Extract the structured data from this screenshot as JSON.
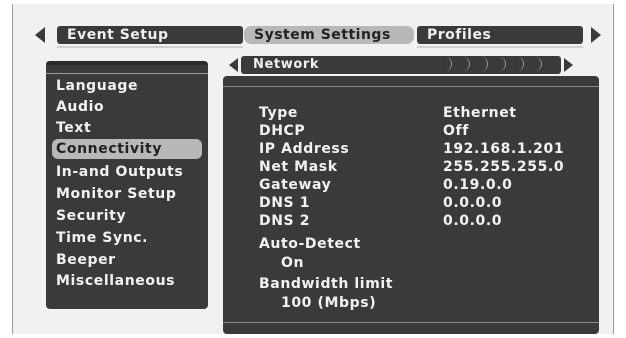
{
  "top_tabs": [
    {
      "label": "Event Setup",
      "selected": false
    },
    {
      "label": "System Settings",
      "selected": true
    },
    {
      "label": "Profiles",
      "selected": false
    }
  ],
  "sidebar": {
    "items": [
      {
        "label": "Language"
      },
      {
        "label": "Audio"
      },
      {
        "label": "Text"
      },
      {
        "label": "Connectivity",
        "active": true
      },
      {
        "label": "In-and Outputs"
      },
      {
        "label": "Monitor Setup"
      },
      {
        "label": "Security"
      },
      {
        "label": "Time Sync."
      },
      {
        "label": "Beeper"
      },
      {
        "label": "Miscellaneous"
      }
    ]
  },
  "network": {
    "tab_label": "Network",
    "rows": [
      {
        "key": "Type",
        "value": "Ethernet"
      },
      {
        "key": "DHCP",
        "value": "Off"
      },
      {
        "key": "IP Address",
        "value": "192.168.1.201"
      },
      {
        "key": "Net Mask",
        "value": "255.255.255.0"
      },
      {
        "key": "Gateway",
        "value": "0.19.0.0"
      },
      {
        "key": "DNS 1",
        "value": "0.0.0.0"
      },
      {
        "key": "DNS 2",
        "value": "0.0.0.0"
      }
    ],
    "auto_detect_label": "Auto-Detect",
    "auto_detect_value": "On",
    "bandwidth_label": "Bandwidth limit",
    "bandwidth_value": "100 (Mbps)"
  },
  "colors": {
    "panel": "#3a3a3a",
    "selected": "#b8b8b8",
    "text": "#f2f2f2"
  }
}
